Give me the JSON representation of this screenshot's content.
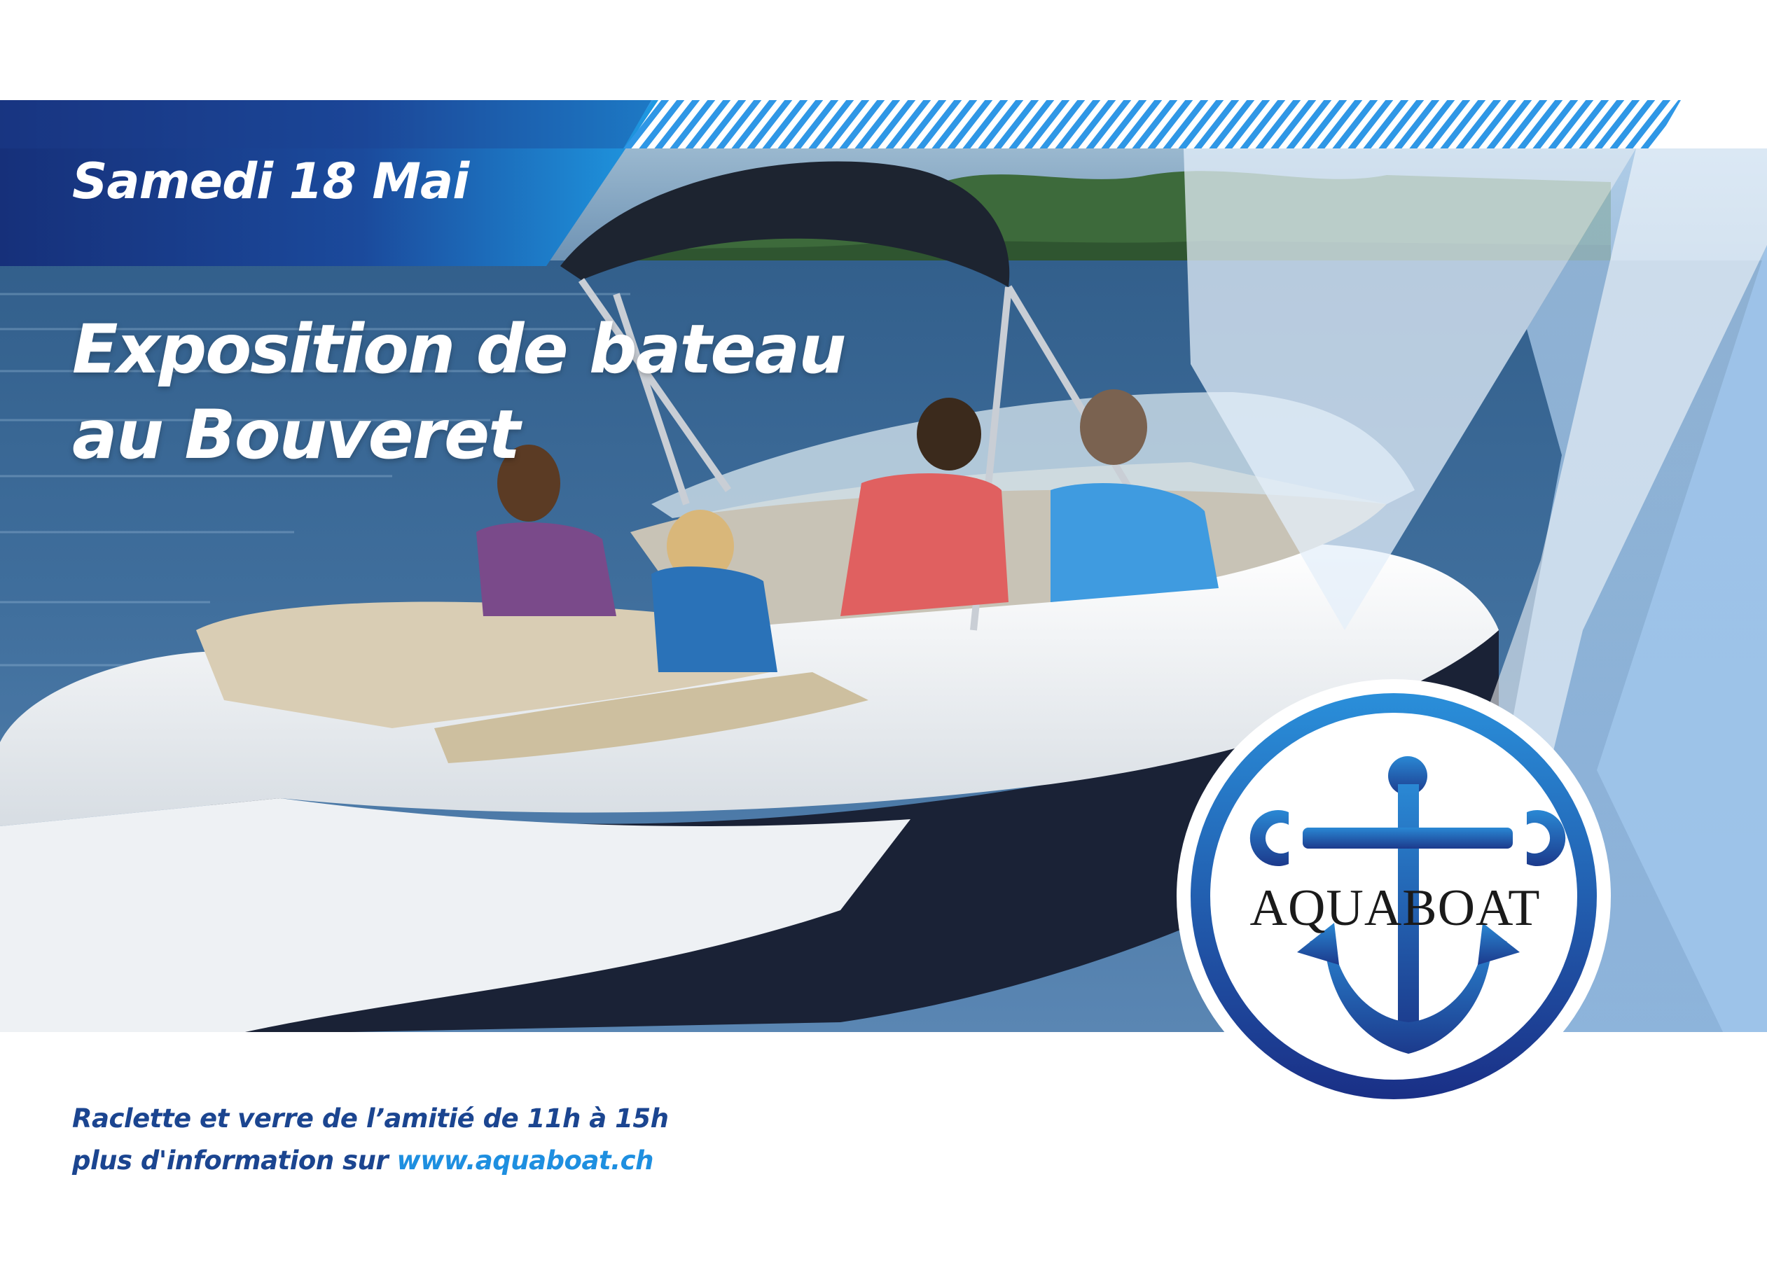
{
  "event": {
    "date": "Samedi 18 Mai",
    "headline_line1": "Exposition de bateau",
    "headline_line2": "au Bouveret"
  },
  "footer": {
    "line1": "Raclette et verre de l’amitié de 11h à 15h",
    "line2_prefix": "plus d'information sur ",
    "website": "www.aquaboat.ch"
  },
  "brand": {
    "name": "AQUABOAT",
    "logo_icon": "anchor-wrench-icon"
  },
  "colors": {
    "navy": "#1b3f8f",
    "blue": "#1e8fe0",
    "light_blue": "#a9cdf0",
    "footer_text": "#1b4590"
  }
}
